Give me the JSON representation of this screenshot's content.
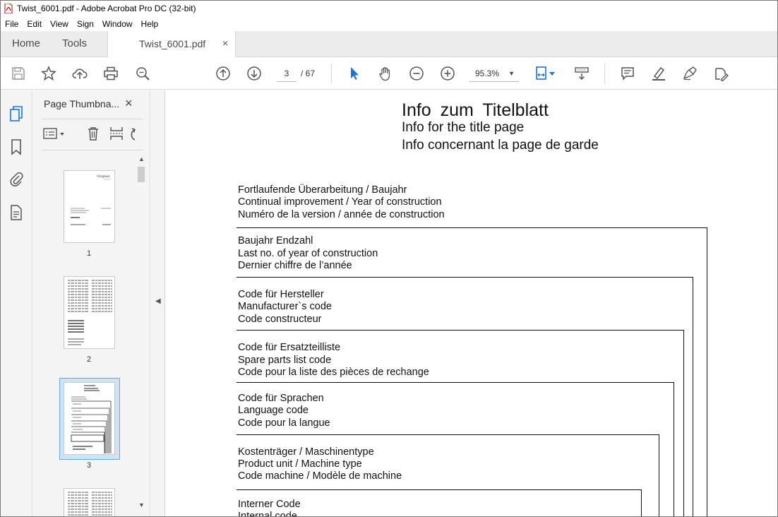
{
  "window": {
    "title": "Twist_6001.pdf - Adobe Acrobat Pro DC (32-bit)"
  },
  "menu": [
    "File",
    "Edit",
    "View",
    "Sign",
    "Window",
    "Help"
  ],
  "tabs": {
    "home": "Home",
    "tools": "Tools",
    "document": "Twist_6001.pdf",
    "close_glyph": "×"
  },
  "toolbar": {
    "current_page": "3",
    "page_separator_total": "/  67",
    "zoom": "95.3%"
  },
  "panel": {
    "title": "Page Thumbna...",
    "close_glyph": "×",
    "thumbnails": [
      {
        "label": "1"
      },
      {
        "label": "2"
      },
      {
        "label": "3",
        "selected": true
      }
    ]
  },
  "document": {
    "heading": "Info  zum  Titelblatt",
    "subheading_en": "Info for the title page",
    "subheading_fr": "Info concernant la page de garde",
    "sections": [
      {
        "lines": [
          "Fortlaufende Überarbeitung / Baujahr",
          "Continual improvement / Year of construction",
          "Numéro de la version / année de construction"
        ]
      },
      {
        "lines": [
          "Baujahr Endzahl",
          "Last no. of year of construction",
          "Dernier chiffre de l’année"
        ]
      },
      {
        "lines": [
          "Code für Hersteller",
          "Manufacturer`s  code",
          "Code constructeur"
        ]
      },
      {
        "lines": [
          "Code für Ersatzteilliste",
          "Spare parts list code",
          "Code pour la liste des pièces de rechange"
        ]
      },
      {
        "lines": [
          "Code für Sprachen",
          "Language code",
          "Code pour la langue"
        ]
      },
      {
        "lines": [
          "Kostenträger / Maschinentype",
          "Product unit / Machine type",
          "Code machine / Modèle de machine"
        ]
      },
      {
        "lines": [
          "Interner Code",
          "Internal code"
        ]
      }
    ]
  },
  "colors": {
    "accent": "#1473e6",
    "tab_bar": "#ececec",
    "panel": "#f4f4f4",
    "selection": "#cfe3f5"
  }
}
